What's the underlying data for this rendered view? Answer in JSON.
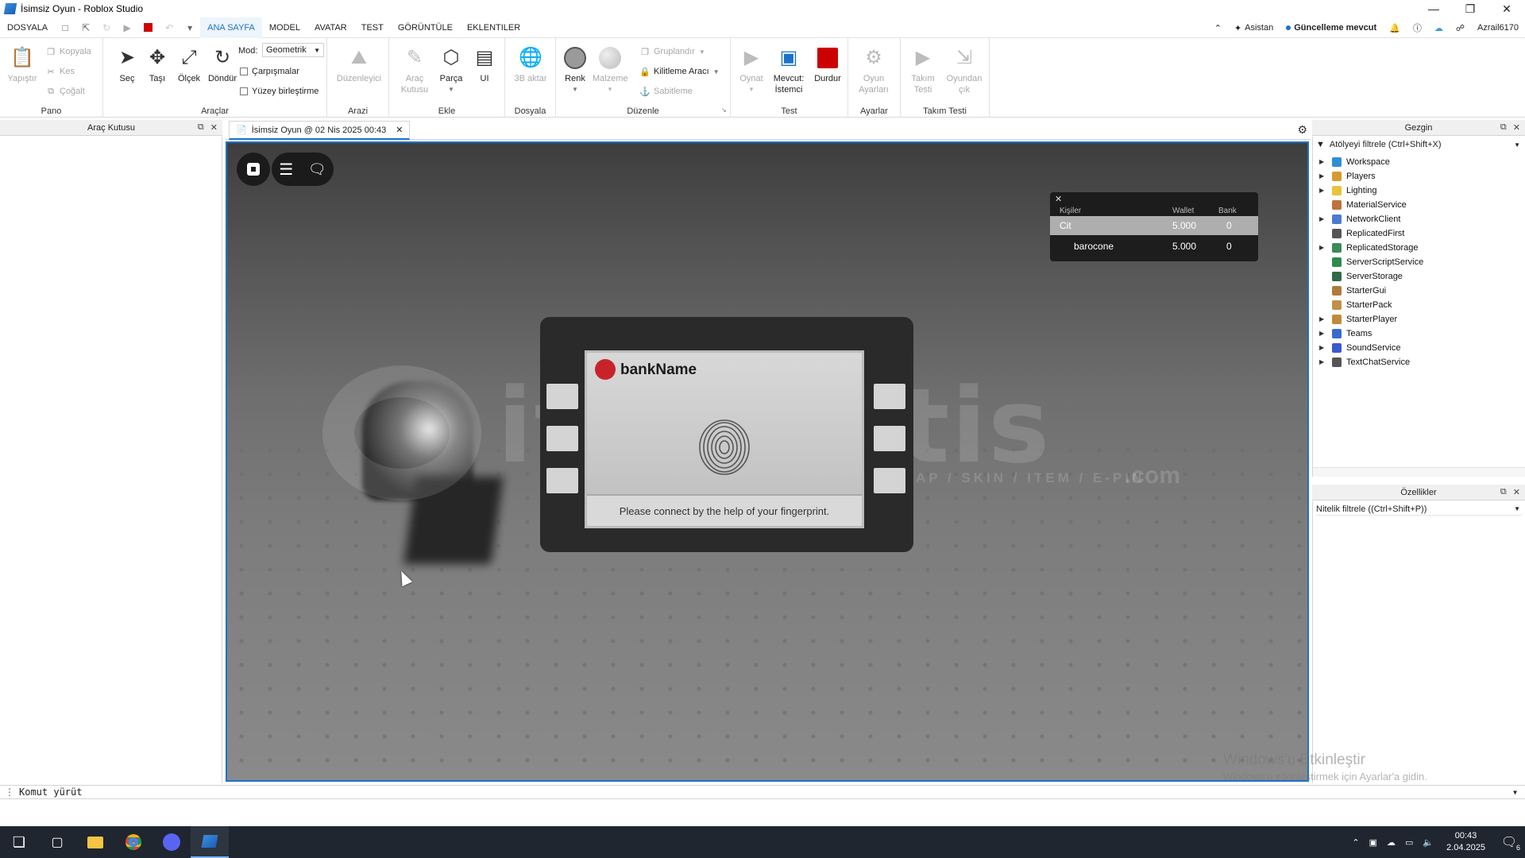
{
  "window": {
    "title": "İsimsiz Oyun - Roblox Studio"
  },
  "menu": {
    "items": [
      "DOSYALA",
      "ANA SAYFA",
      "MODEL",
      "AVATAR",
      "TEST",
      "GÖRÜNTÜLE",
      "EKLENTILER"
    ],
    "active": "ANA SAYFA",
    "assistant": "Asistan",
    "update": "Güncelleme mevcut",
    "user": "Azrail6170"
  },
  "ribbon": {
    "pano": {
      "name": "Pano",
      "paste": "Yapıştır",
      "copy": "Kopyala",
      "cut": "Kes",
      "duplicate": "Çoğalt"
    },
    "araclar": {
      "name": "Araçlar",
      "select": "Seç",
      "move": "Taşı",
      "scale": "Ölçek",
      "rotate": "Döndür",
      "mode_label": "Mod:",
      "mode_value": "Geometrik",
      "collisions": "Çarpışmalar",
      "surface_join": "Yüzey birleştirme"
    },
    "arazi": {
      "name": "Arazi",
      "editor": "Düzenleyici"
    },
    "ekle": {
      "name": "Ekle",
      "toolbox": "Araç Kutusu",
      "part": "Parça",
      "ui": "UI"
    },
    "dosya": {
      "name": "Dosyala",
      "import3d": "3B aktar"
    },
    "duzenle": {
      "name": "Düzenle",
      "color": "Renk",
      "material": "Malzeme",
      "group": "Gruplandır",
      "lock_tool": "Kilitleme Aracı",
      "anchor": "Sabitleme"
    },
    "test": {
      "name": "Test",
      "play": "Oynat",
      "current_client": "Mevcut: İstemci",
      "stop": "Durdur"
    },
    "ayarlar": {
      "name": "Ayarlar",
      "game_settings": "Oyun Ayarları"
    },
    "takim": {
      "name": "Takım Testi",
      "team_test": "Takım Testi",
      "exit_game": "Oyundan çık"
    }
  },
  "toolbox_panel": {
    "title": "Araç Kutusu"
  },
  "document_tab": {
    "label": "İsimsiz Oyun @ 02 Nis 2025 00:43"
  },
  "leaderboard": {
    "headers": {
      "people": "Kişiler",
      "wallet": "Wallet",
      "bank": "Bank"
    },
    "team": {
      "name": "Cit",
      "wallet": "5.000",
      "bank": "0"
    },
    "players": [
      {
        "name": "barocone",
        "wallet": "5.000",
        "bank": "0"
      }
    ]
  },
  "atm": {
    "bank_name": "bankName",
    "message": "Please connect by the help of your fingerprint."
  },
  "watermark": {
    "main": "itemsatis",
    "sub": "HESAP / SKIN / ITEM / E-PIN",
    "com": ".com"
  },
  "explorer": {
    "title": "Gezgin",
    "filter_placeholder": "Atölyeyi filtrele (Ctrl+Shift+X)",
    "items": [
      {
        "name": "Workspace",
        "expandable": true,
        "color": "#2f8fd6"
      },
      {
        "name": "Players",
        "expandable": true,
        "color": "#d69a2f"
      },
      {
        "name": "Lighting",
        "expandable": true,
        "color": "#e8c43a"
      },
      {
        "name": "MaterialService",
        "expandable": false,
        "color": "#c0703a"
      },
      {
        "name": "NetworkClient",
        "expandable": true,
        "color": "#4a7bd0"
      },
      {
        "name": "ReplicatedFirst",
        "expandable": false,
        "color": "#555555"
      },
      {
        "name": "ReplicatedStorage",
        "expandable": true,
        "color": "#3a8a5a"
      },
      {
        "name": "ServerScriptService",
        "expandable": false,
        "color": "#2f8a50"
      },
      {
        "name": "ServerStorage",
        "expandable": false,
        "color": "#2f6a4a"
      },
      {
        "name": "StarterGui",
        "expandable": false,
        "color": "#b07a3a"
      },
      {
        "name": "StarterPack",
        "expandable": false,
        "color": "#c0904a"
      },
      {
        "name": "StarterPlayer",
        "expandable": true,
        "color": "#c08a3a"
      },
      {
        "name": "Teams",
        "expandable": true,
        "color": "#3a6ad0"
      },
      {
        "name": "SoundService",
        "expandable": true,
        "color": "#3a5ad0"
      },
      {
        "name": "TextChatService",
        "expandable": true,
        "color": "#555555"
      }
    ]
  },
  "properties": {
    "title": "Özellikler",
    "filter_placeholder": "Nitelik filtrele ((Ctrl+Shift+P))"
  },
  "command_bar": {
    "placeholder": "Komut yürüt"
  },
  "windows_activation": {
    "line1": "Windows'u Etkinleştir",
    "line2": "Windows'u etkinleştirmek için Ayarlar'a gidin."
  },
  "taskbar": {
    "time": "00:43",
    "date": "2.04.2025",
    "notifications": "6"
  }
}
